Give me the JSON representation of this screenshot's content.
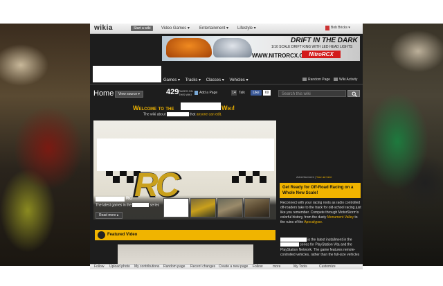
{
  "global_nav": {
    "logo": "wikia",
    "start_wiki": "Start a wiki",
    "hubs": [
      "Video Games ▾",
      "Entertainment ▾",
      "Lifestyle ▾"
    ],
    "user": "Bob Bricks ▾"
  },
  "ad": {
    "title": "DRIFT IN THE DARK",
    "subtitle": "1/10 SCALE DRIFT KING WITH LED HEAD LIGHTS",
    "url": "WWW.NITRORCX.COM",
    "logo": "NitroRCX"
  },
  "local_nav": {
    "items": [
      "Games ▾",
      "Tracks ▾",
      "Classes ▾",
      "Vehicles ▾"
    ],
    "random_page": "Random Page",
    "wiki_activity": "Wiki Activity"
  },
  "page_header": {
    "title": "Home",
    "view_source": "View source ▾",
    "page_count": "429",
    "page_count_label": "PAGES ON THIS WIKI",
    "add_page": "Add a Page",
    "talk_count": "14",
    "talk": "Talk",
    "fb_like": "Like",
    "fb_count": "69",
    "search_placeholder": "Search this wiki"
  },
  "welcome": {
    "prefix": "Welcome to the",
    "suffix": "Wiki!",
    "about_prefix": "The wiki about",
    "about_mid": "that",
    "about_link": "anyone can edit."
  },
  "hero": {
    "caption_suffix": "RC",
    "caption_text_prefix": "The latest games in the",
    "caption_text_suffix": "series",
    "read_more": "Read more ▸"
  },
  "featured": {
    "label": "Featured Video"
  },
  "rail": {
    "ad_note": "Advertisement | ",
    "ad_note_link": "Your ad here",
    "promo_title": "Get Ready for Off-Road Racing on a Whole New Scale!",
    "p1_a": "Reconnect with your racing roots as radio controlled off-roaders take to the track for old-school racing just like you remember. Compete through MotorStorm's colorful history, from the dusty",
    "p1_link1": "Monument Valley",
    "p1_b": "to the ruins of the",
    "p1_link2": "Apocalypse.",
    "p2_a": "is the latest installment in the",
    "p2_b": "series for PlayStation Vita and the PlayStation Network. The game features remote-controlled vehicles, rather than the full-size vehicles"
  },
  "toolbar": {
    "items": [
      "Follow",
      "Upload photo",
      "My contributions",
      "Random page",
      "Recent changes",
      "Create a new page",
      "Follow",
      "more",
      "My Tools",
      "Customize"
    ]
  },
  "colors": {
    "accent": "#f0b400",
    "page_bg": "#1d1d1d",
    "facebook": "#3b5998"
  }
}
